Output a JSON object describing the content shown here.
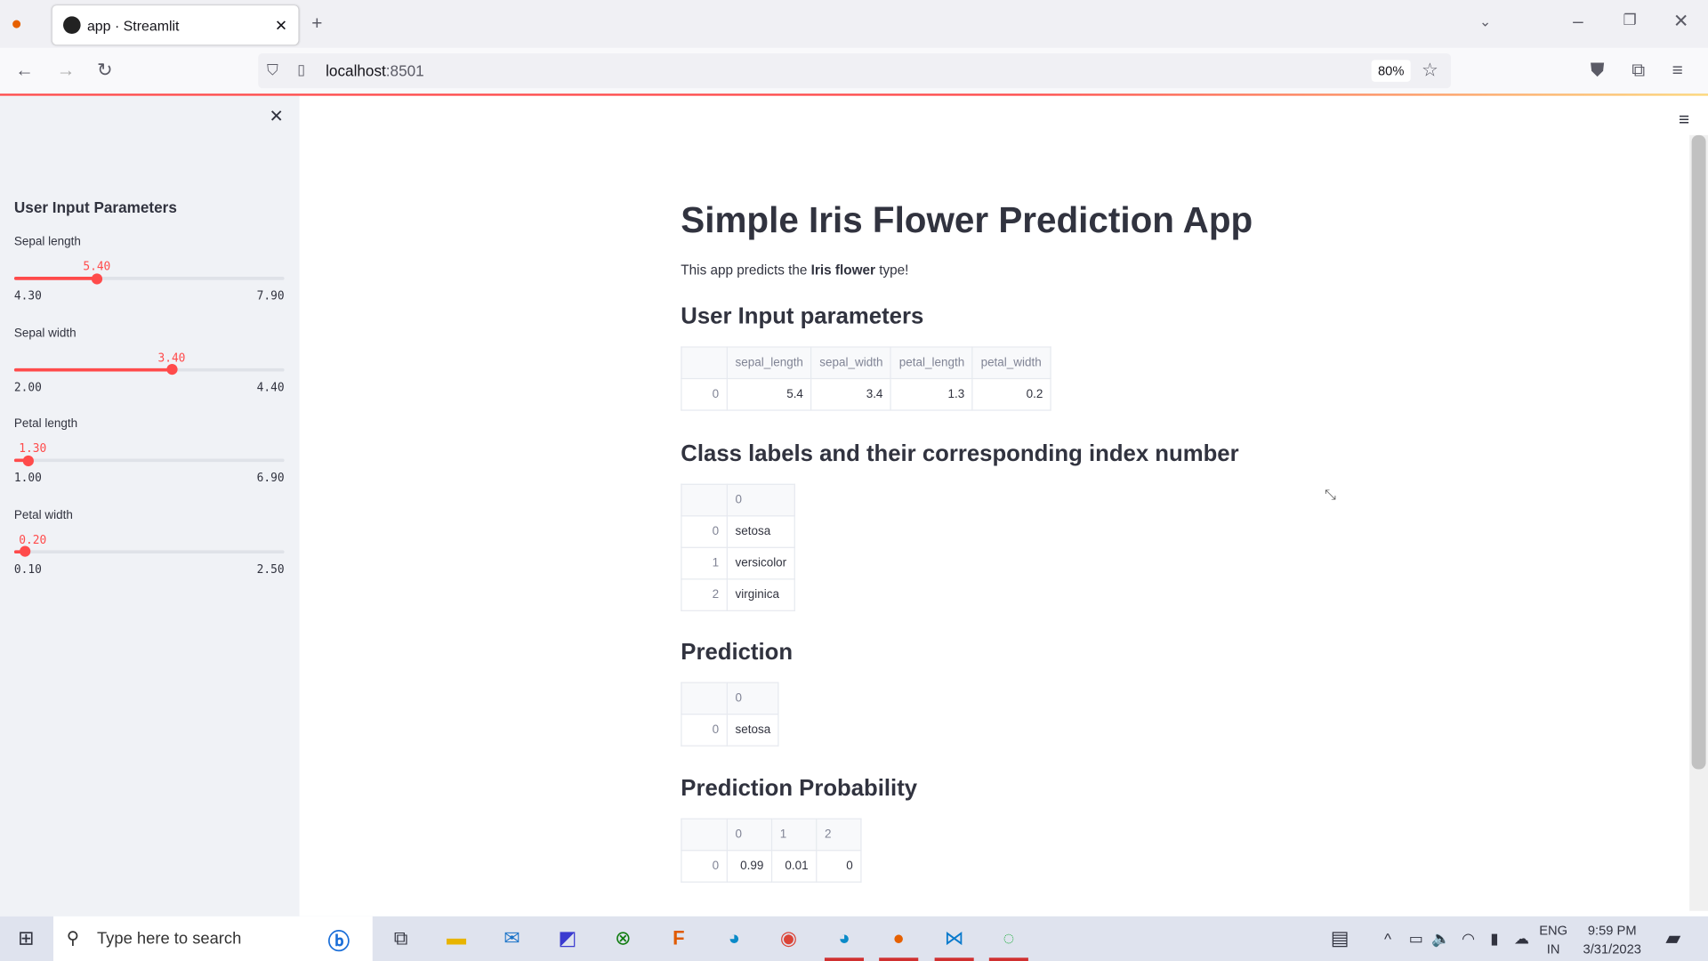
{
  "browser": {
    "tab_title": "app · Streamlit",
    "url_host": "localhost",
    "url_port": ":8501",
    "zoom": "80%"
  },
  "sidebar": {
    "title": "User Input Parameters",
    "sliders": [
      {
        "label": "Sepal length",
        "value": "5.40",
        "min": "4.30",
        "max": "7.90",
        "fraction": 0.306
      },
      {
        "label": "Sepal width",
        "value": "3.40",
        "min": "2.00",
        "max": "4.40",
        "fraction": 0.583
      },
      {
        "label": "Petal length",
        "value": "1.30",
        "min": "1.00",
        "max": "6.90",
        "fraction": 0.051
      },
      {
        "label": "Petal width",
        "value": "0.20",
        "min": "0.10",
        "max": "2.50",
        "fraction": 0.042
      }
    ]
  },
  "main": {
    "title": "Simple Iris Flower Prediction App",
    "intro_pre": "This app predicts the ",
    "intro_bold": "Iris flower",
    "intro_post": " type!",
    "h_input": "User Input parameters",
    "input_table": {
      "columns": [
        "sepal_length",
        "sepal_width",
        "petal_length",
        "petal_width"
      ],
      "rows": [
        {
          "index": "0",
          "values": [
            "5.4",
            "3.4",
            "1.3",
            "0.2"
          ]
        }
      ]
    },
    "h_classes": "Class labels and their corresponding index number",
    "class_table": {
      "columns": [
        "0"
      ],
      "rows": [
        {
          "index": "0",
          "values": [
            "setosa"
          ]
        },
        {
          "index": "1",
          "values": [
            "versicolor"
          ]
        },
        {
          "index": "2",
          "values": [
            "virginica"
          ]
        }
      ]
    },
    "h_prediction": "Prediction",
    "prediction_table": {
      "columns": [
        "0"
      ],
      "rows": [
        {
          "index": "0",
          "values": [
            "setosa"
          ]
        }
      ]
    },
    "h_probability": "Prediction Probability",
    "probability_table": {
      "columns": [
        "0",
        "1",
        "2"
      ],
      "rows": [
        {
          "index": "0",
          "values": [
            "0.99",
            "0.01",
            "0"
          ]
        }
      ]
    }
  },
  "taskbar": {
    "search_placeholder": "Type here to search",
    "lang1": "ENG",
    "lang2": "IN",
    "time": "9:59 PM",
    "date": "3/31/2023"
  }
}
